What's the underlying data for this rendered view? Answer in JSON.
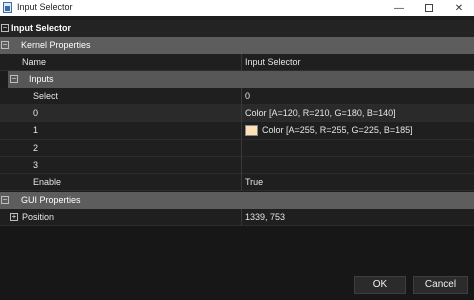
{
  "window": {
    "title": "Input Selector",
    "minimize_glyph": "—",
    "close_glyph": "✕"
  },
  "grid": {
    "root": {
      "label": "Input Selector",
      "expander": "−"
    },
    "kernel": {
      "label": "Kernel Properties",
      "expander": "−"
    },
    "name_prop": {
      "name": "Name",
      "value": "Input Selector"
    },
    "inputs": {
      "label": "Inputs",
      "expander": "−"
    },
    "select_prop": {
      "name": "Select",
      "value": "0"
    },
    "in0": {
      "name": "0",
      "value": "Color [A=120, R=210, G=180, B=140]"
    },
    "in1": {
      "name": "1",
      "value": "Color [A=255, R=255, G=225, B=185]",
      "swatch_color": "#ffe1b9"
    },
    "in2": {
      "name": "2",
      "value": ""
    },
    "in3": {
      "name": "3",
      "value": ""
    },
    "enable_prop": {
      "name": "Enable",
      "value": "True"
    },
    "gui": {
      "label": "GUI Properties",
      "expander": "−"
    },
    "position_prop": {
      "name": "Position",
      "value": "1339, 753",
      "expander": "+"
    }
  },
  "buttons": {
    "ok": "OK",
    "cancel": "Cancel"
  },
  "colors": {
    "background": "#1e1e1e",
    "category_bar": "#5d5d5d",
    "text": "#e8e8e8"
  }
}
